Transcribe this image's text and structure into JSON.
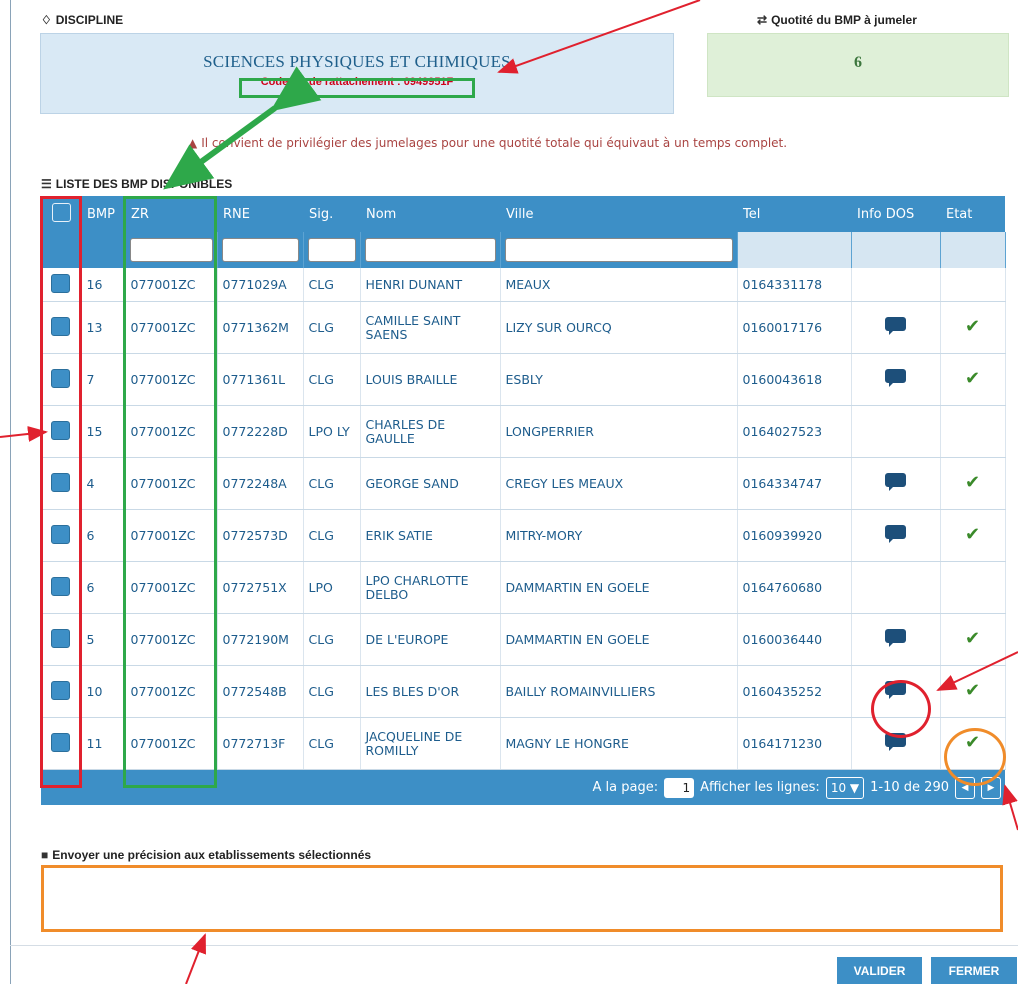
{
  "discipline": {
    "label": "DISCIPLINE",
    "value": "SCIENCES PHYSIQUES ET CHIMIQUES",
    "code": "Code ZR de rattachement : 0949951F"
  },
  "quotite": {
    "label": "Quotité du BMP à jumeler",
    "value": "6"
  },
  "warning": "Il convient de privilégier des jumelages pour une quotité totale qui équivaut à un temps complet.",
  "list_title": "LISTE DES BMP DISPONIBLES",
  "columns": [
    "BMP",
    "ZR",
    "RNE",
    "Sig.",
    "Nom",
    "Ville",
    "Tel",
    "Info DOS",
    "Etat"
  ],
  "rows": [
    {
      "bmp": "16",
      "zr": "077001ZC",
      "rne": "0771029A",
      "sig": "CLG",
      "nom": "HENRI DUNANT",
      "ville": "MEAUX",
      "tel": "0164331178",
      "info": false,
      "etat": false
    },
    {
      "bmp": "13",
      "zr": "077001ZC",
      "rne": "0771362M",
      "sig": "CLG",
      "nom": "CAMILLE SAINT SAENS",
      "ville": "LIZY SUR OURCQ",
      "tel": "0160017176",
      "info": true,
      "etat": true
    },
    {
      "bmp": "7",
      "zr": "077001ZC",
      "rne": "0771361L",
      "sig": "CLG",
      "nom": "LOUIS BRAILLE",
      "ville": "ESBLY",
      "tel": "0160043618",
      "info": true,
      "etat": true
    },
    {
      "bmp": "15",
      "zr": "077001ZC",
      "rne": "0772228D",
      "sig": "LPO LY",
      "nom": "CHARLES DE GAULLE",
      "ville": "LONGPERRIER",
      "tel": "0164027523",
      "info": false,
      "etat": false
    },
    {
      "bmp": "4",
      "zr": "077001ZC",
      "rne": "0772248A",
      "sig": "CLG",
      "nom": "GEORGE SAND",
      "ville": "CREGY LES MEAUX",
      "tel": "0164334747",
      "info": true,
      "etat": true
    },
    {
      "bmp": "6",
      "zr": "077001ZC",
      "rne": "0772573D",
      "sig": "CLG",
      "nom": "ERIK SATIE",
      "ville": "MITRY-MORY",
      "tel": "0160939920",
      "info": true,
      "etat": true
    },
    {
      "bmp": "6",
      "zr": "077001ZC",
      "rne": "0772751X",
      "sig": "LPO",
      "nom": "LPO CHARLOTTE DELBO",
      "ville": "DAMMARTIN EN GOELE",
      "tel": "0164760680",
      "info": false,
      "etat": false
    },
    {
      "bmp": "5",
      "zr": "077001ZC",
      "rne": "0772190M",
      "sig": "CLG",
      "nom": "DE L'EUROPE",
      "ville": "DAMMARTIN EN GOELE",
      "tel": "0160036440",
      "info": true,
      "etat": true
    },
    {
      "bmp": "10",
      "zr": "077001ZC",
      "rne": "0772548B",
      "sig": "CLG",
      "nom": "LES BLES D'OR",
      "ville": "BAILLY ROMAINVILLIERS",
      "tel": "0160435252",
      "info": true,
      "etat": true
    },
    {
      "bmp": "11",
      "zr": "077001ZC",
      "rne": "0772713F",
      "sig": "CLG",
      "nom": "JACQUELINE DE ROMILLY",
      "ville": "MAGNY LE HONGRE",
      "tel": "0164171230",
      "info": true,
      "etat": true
    }
  ],
  "pagination": {
    "page_label": "A la page:",
    "page_value": "1",
    "rows_label": "Afficher les lignes:",
    "rows_value": "10",
    "range": "1-10 de 290"
  },
  "message_label": "Envoyer une précision aux etablissements sélectionnés",
  "buttons": {
    "valider": "VALIDER",
    "fermer": "FERMER"
  },
  "colors": {
    "header_blue": "#3d8fc6",
    "text_blue": "#1d5c8c",
    "check_green": "#3a8a2a"
  }
}
